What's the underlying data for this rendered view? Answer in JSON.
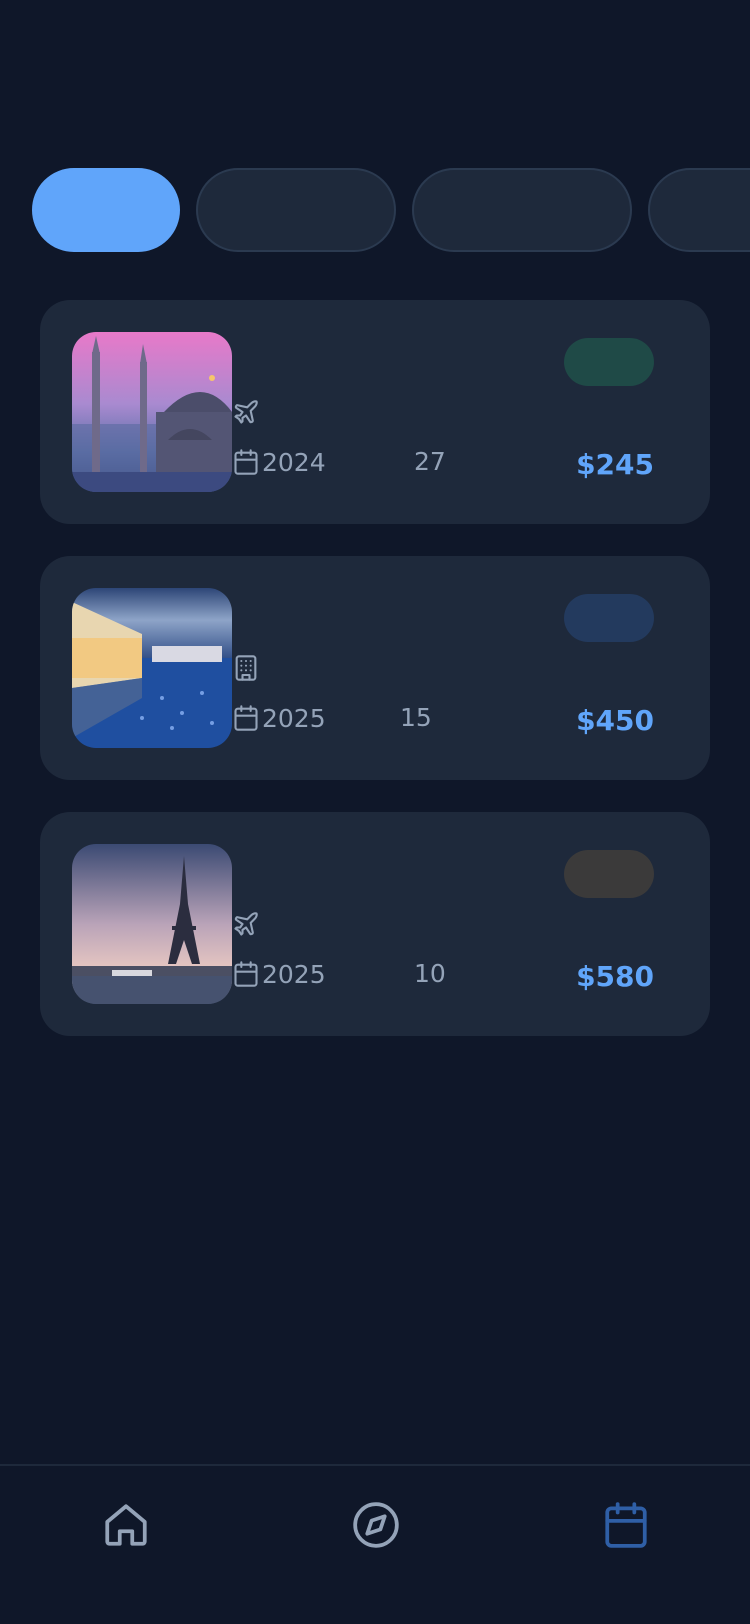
{
  "filters": [
    {
      "label": "",
      "active": true
    },
    {
      "label": "",
      "active": false
    },
    {
      "label": "",
      "active": false
    },
    {
      "label": "",
      "active": false
    }
  ],
  "bookings": [
    {
      "image": "istanbul-mosque-photo",
      "type_icon": "plane-icon",
      "date": "2024",
      "nights": "27",
      "price": "$245",
      "status_color": "#1f4a47"
    },
    {
      "image": "hotel-pool-photo",
      "type_icon": "building-icon",
      "date": "2025",
      "nights": "15",
      "price": "$450",
      "status_color": "#233a5e"
    },
    {
      "image": "eiffel-tower-photo",
      "type_icon": "plane-icon",
      "date": "2025",
      "nights": "10",
      "price": "$580",
      "status_color": "#3b3a3a"
    }
  ],
  "nav": {
    "items": [
      "home-icon",
      "compass-icon",
      "calendar-icon"
    ],
    "active": "calendar-icon"
  },
  "colors": {
    "background": "#0f1729",
    "card": "#1e293b",
    "accent": "#60a5fa",
    "muted_text": "#94a3b8"
  }
}
